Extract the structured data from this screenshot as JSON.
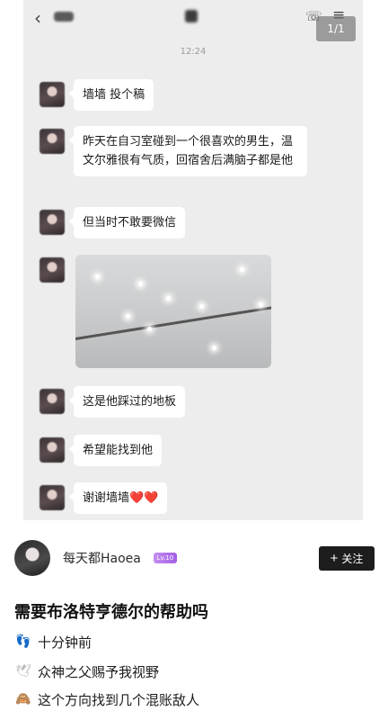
{
  "screenshot": {
    "time": "12:24",
    "page_indicator": "1/1",
    "messages": [
      {
        "text": "墙墙 投个稿"
      },
      {
        "text": "昨天在自习室碰到一个很喜欢的男生，温文尔雅很有气质，回宿舍后满脑子都是他"
      },
      {
        "text": "但当时不敢要微信"
      },
      {
        "text": "这是他踩过的地板"
      },
      {
        "text": "希望能找到他"
      },
      {
        "text": "谢谢墙墙❤️❤️"
      }
    ]
  },
  "post": {
    "author_name": "每天都Haoea",
    "level_badge": "Lv.10",
    "follow_label": "关注",
    "title": "需要布洛特亨德尔的帮助吗",
    "lines": [
      {
        "icon": "footprints-icon",
        "text": "十分钟前"
      },
      {
        "icon": "dove-icon",
        "text": "众神之父赐予我视野"
      },
      {
        "icon": "monkey-icon",
        "text": "这个方向找到几个混账敌人"
      }
    ]
  },
  "colors": {
    "chat_background": "#ededed",
    "bubble": "#ffffff",
    "follow_button": "#1d1d1d",
    "level_badge": "#b377ec"
  }
}
